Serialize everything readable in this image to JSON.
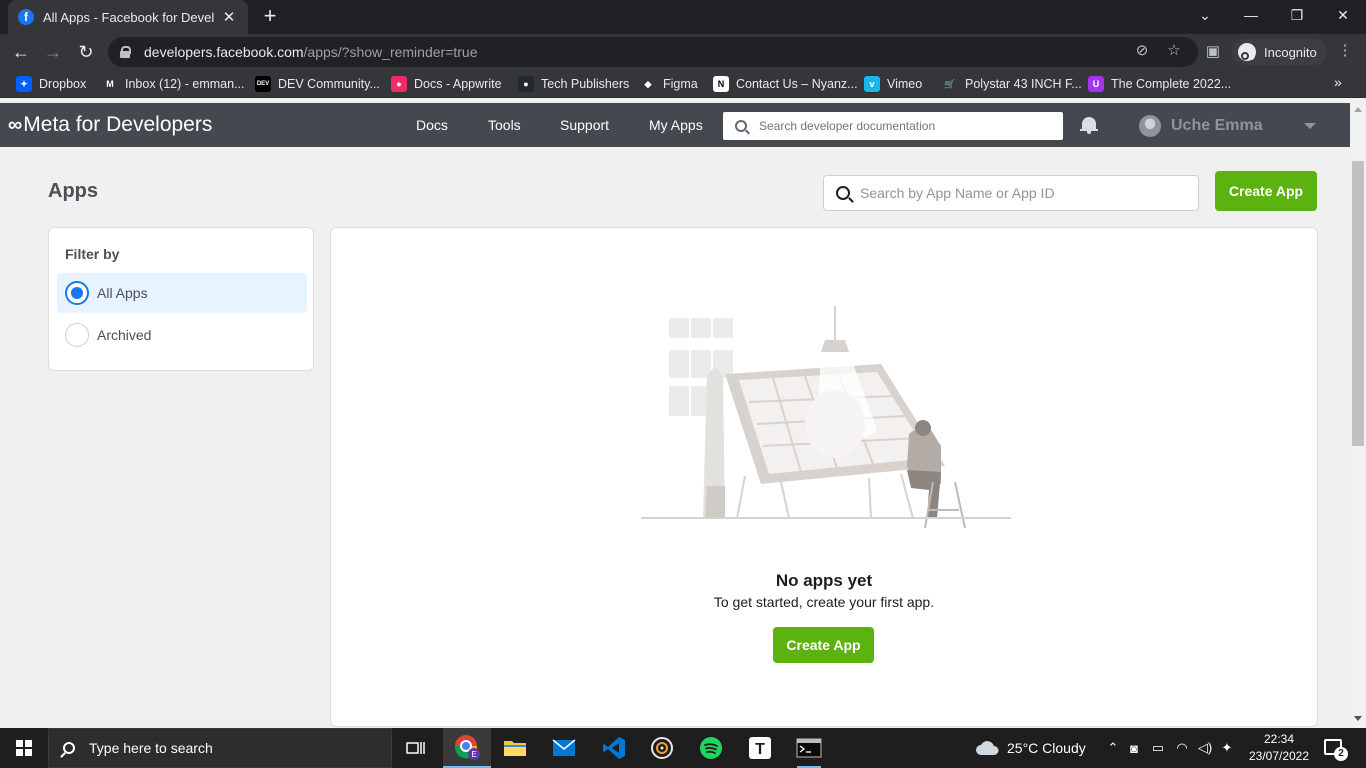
{
  "browser": {
    "tab_title": "All Apps - Facebook for Developers",
    "tab_favicon_letter": "f",
    "url_host": "developers.facebook.com",
    "url_path": "/apps/?show_reminder=true",
    "incognito_label": "Incognito"
  },
  "bookmarks": [
    {
      "label": "Dropbox",
      "icon": "dropbox-icon",
      "color": "#0061ff",
      "glyph": "✦"
    },
    {
      "label": "Inbox (12) - emman...",
      "icon": "gmail-icon",
      "color": "#35363a",
      "glyph": "M"
    },
    {
      "label": "DEV Community...",
      "icon": "dev-icon",
      "color": "#000000",
      "glyph": "DEV"
    },
    {
      "label": "Docs - Appwrite",
      "icon": "appwrite-icon",
      "color": "#f02e65",
      "glyph": "●"
    },
    {
      "label": "Tech Publishers",
      "icon": "github-icon",
      "color": "#24292e",
      "glyph": "●"
    },
    {
      "label": "Figma",
      "icon": "figma-icon",
      "color": "#35363a",
      "glyph": "◆"
    },
    {
      "label": "Contact Us – Nyanz...",
      "icon": "notion-icon",
      "color": "#ffffff",
      "glyph": "N"
    },
    {
      "label": "Vimeo",
      "icon": "vimeo-icon",
      "color": "#1ab7ea",
      "glyph": "v"
    },
    {
      "label": "Polystar 43 INCH F...",
      "icon": "cart-icon",
      "color": "#35363a",
      "glyph": "🛒"
    },
    {
      "label": "The Complete 2022...",
      "icon": "udemy-icon",
      "color": "#a435f0",
      "glyph": "U"
    }
  ],
  "bookmarks_overflow": "»",
  "meta_nav": {
    "logo_text": "Meta for Developers",
    "links": [
      "Docs",
      "Tools",
      "Support",
      "My Apps"
    ],
    "search_placeholder": "Search developer documentation",
    "user_name": "Uche Emma"
  },
  "page": {
    "title": "Apps",
    "search_placeholder": "Search by App Name or App ID",
    "create_app_label": "Create App",
    "filter": {
      "heading": "Filter by",
      "options": [
        {
          "label": "All Apps",
          "selected": true
        },
        {
          "label": "Archived",
          "selected": false
        }
      ]
    },
    "empty_state": {
      "title": "No apps yet",
      "subtitle": "To get started, create your first app.",
      "button_label": "Create App"
    }
  },
  "taskbar": {
    "search_placeholder": "Type here to search",
    "weather": "25°C  Cloudy",
    "time": "22:34",
    "date": "23/07/2022",
    "notification_count": "2"
  },
  "colors": {
    "accent_green": "#5cb20e",
    "meta_nav_bg": "#444950",
    "radio_blue": "#1877f2"
  }
}
